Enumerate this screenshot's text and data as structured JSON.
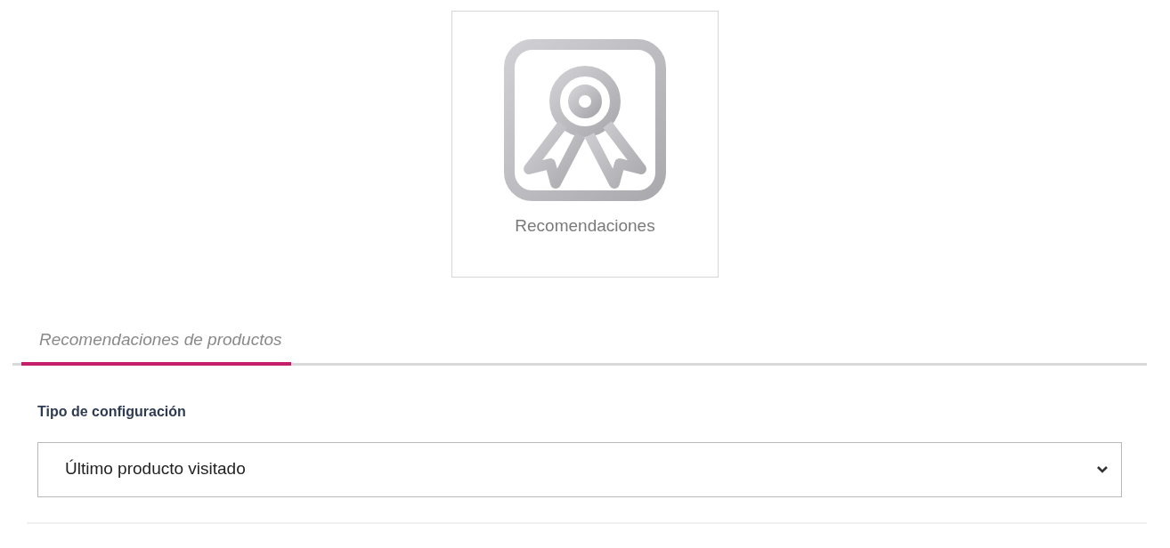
{
  "module_tile": {
    "label": "Recomendaciones"
  },
  "tabs": [
    {
      "label": "Recomendaciones de productos",
      "selected": true
    }
  ],
  "config": {
    "label": "Tipo de configuración",
    "value": "Último producto visitado"
  }
}
